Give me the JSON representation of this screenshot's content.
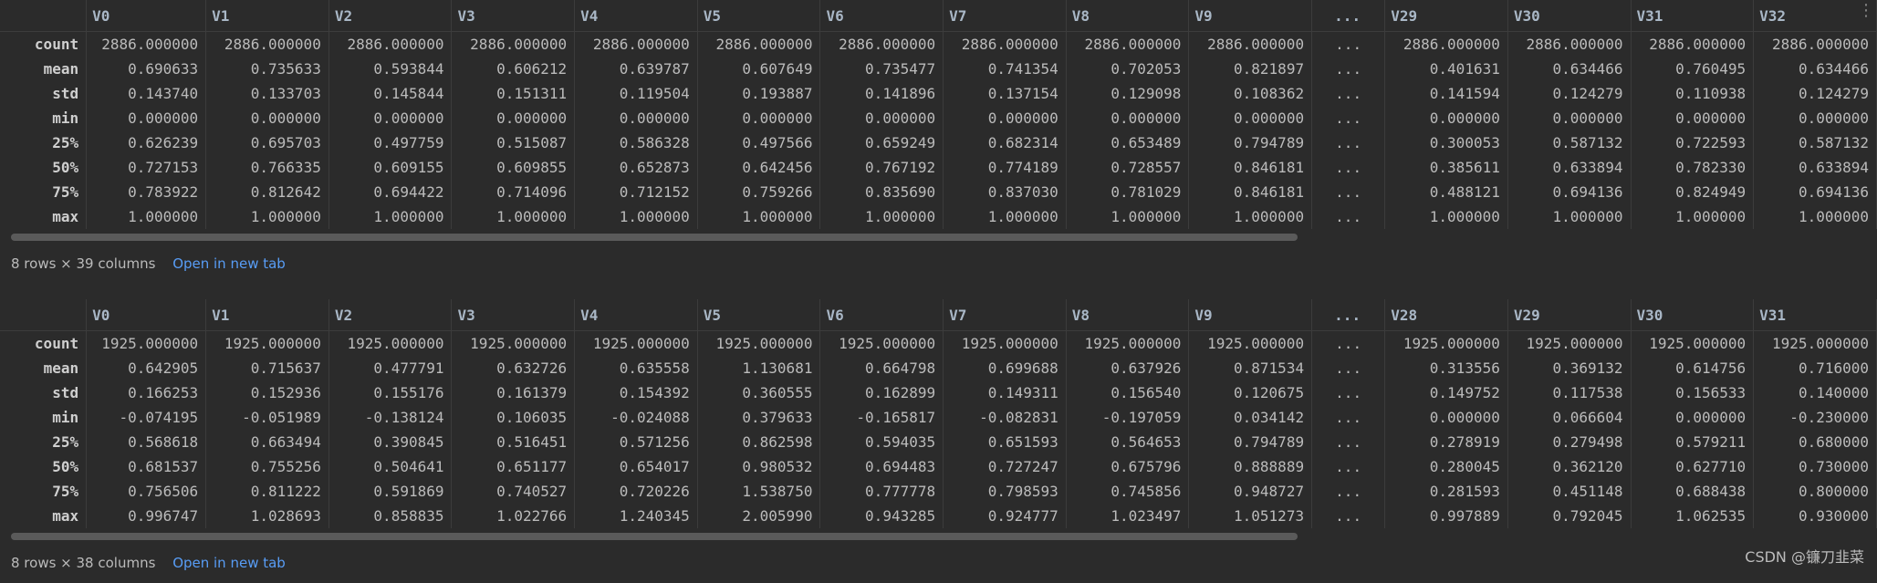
{
  "tables": [
    {
      "columns": [
        "",
        "V0",
        "V1",
        "V2",
        "V3",
        "V4",
        "V5",
        "V6",
        "V7",
        "V8",
        "V9",
        "...",
        "V29",
        "V30",
        "V31",
        "V32"
      ],
      "rows": [
        {
          "label": "count",
          "values": [
            "2886.000000",
            "2886.000000",
            "2886.000000",
            "2886.000000",
            "2886.000000",
            "2886.000000",
            "2886.000000",
            "2886.000000",
            "2886.000000",
            "2886.000000",
            "...",
            "2886.000000",
            "2886.000000",
            "2886.000000",
            "2886.000000"
          ]
        },
        {
          "label": "mean",
          "values": [
            "0.690633",
            "0.735633",
            "0.593844",
            "0.606212",
            "0.639787",
            "0.607649",
            "0.735477",
            "0.741354",
            "0.702053",
            "0.821897",
            "...",
            "0.401631",
            "0.634466",
            "0.760495",
            "0.634466"
          ]
        },
        {
          "label": "std",
          "values": [
            "0.143740",
            "0.133703",
            "0.145844",
            "0.151311",
            "0.119504",
            "0.193887",
            "0.141896",
            "0.137154",
            "0.129098",
            "0.108362",
            "...",
            "0.141594",
            "0.124279",
            "0.110938",
            "0.124279"
          ]
        },
        {
          "label": "min",
          "values": [
            "0.000000",
            "0.000000",
            "0.000000",
            "0.000000",
            "0.000000",
            "0.000000",
            "0.000000",
            "0.000000",
            "0.000000",
            "0.000000",
            "...",
            "0.000000",
            "0.000000",
            "0.000000",
            "0.000000"
          ]
        },
        {
          "label": "25%",
          "values": [
            "0.626239",
            "0.695703",
            "0.497759",
            "0.515087",
            "0.586328",
            "0.497566",
            "0.659249",
            "0.682314",
            "0.653489",
            "0.794789",
            "...",
            "0.300053",
            "0.587132",
            "0.722593",
            "0.587132"
          ]
        },
        {
          "label": "50%",
          "values": [
            "0.727153",
            "0.766335",
            "0.609155",
            "0.609855",
            "0.652873",
            "0.642456",
            "0.767192",
            "0.774189",
            "0.728557",
            "0.846181",
            "...",
            "0.385611",
            "0.633894",
            "0.782330",
            "0.633894"
          ]
        },
        {
          "label": "75%",
          "values": [
            "0.783922",
            "0.812642",
            "0.694422",
            "0.714096",
            "0.712152",
            "0.759266",
            "0.835690",
            "0.837030",
            "0.781029",
            "0.846181",
            "...",
            "0.488121",
            "0.694136",
            "0.824949",
            "0.694136"
          ]
        },
        {
          "label": "max",
          "values": [
            "1.000000",
            "1.000000",
            "1.000000",
            "1.000000",
            "1.000000",
            "1.000000",
            "1.000000",
            "1.000000",
            "1.000000",
            "1.000000",
            "...",
            "1.000000",
            "1.000000",
            "1.000000",
            "1.000000"
          ]
        }
      ],
      "footer_text": "8 rows × 39 columns",
      "open_link": "Open in new tab"
    },
    {
      "columns": [
        "",
        "V0",
        "V1",
        "V2",
        "V3",
        "V4",
        "V5",
        "V6",
        "V7",
        "V8",
        "V9",
        "...",
        "V28",
        "V29",
        "V30",
        "V31"
      ],
      "rows": [
        {
          "label": "count",
          "values": [
            "1925.000000",
            "1925.000000",
            "1925.000000",
            "1925.000000",
            "1925.000000",
            "1925.000000",
            "1925.000000",
            "1925.000000",
            "1925.000000",
            "1925.000000",
            "...",
            "1925.000000",
            "1925.000000",
            "1925.000000",
            "1925.000000"
          ]
        },
        {
          "label": "mean",
          "values": [
            "0.642905",
            "0.715637",
            "0.477791",
            "0.632726",
            "0.635558",
            "1.130681",
            "0.664798",
            "0.699688",
            "0.637926",
            "0.871534",
            "...",
            "0.313556",
            "0.369132",
            "0.614756",
            "0.716000"
          ]
        },
        {
          "label": "std",
          "values": [
            "0.166253",
            "0.152936",
            "0.155176",
            "0.161379",
            "0.154392",
            "0.360555",
            "0.162899",
            "0.149311",
            "0.156540",
            "0.120675",
            "...",
            "0.149752",
            "0.117538",
            "0.156533",
            "0.140000"
          ]
        },
        {
          "label": "min",
          "values": [
            "-0.074195",
            "-0.051989",
            "-0.138124",
            "0.106035",
            "-0.024088",
            "0.379633",
            "-0.165817",
            "-0.082831",
            "-0.197059",
            "0.034142",
            "...",
            "0.000000",
            "0.066604",
            "0.000000",
            "-0.230000"
          ]
        },
        {
          "label": "25%",
          "values": [
            "0.568618",
            "0.663494",
            "0.390845",
            "0.516451",
            "0.571256",
            "0.862598",
            "0.594035",
            "0.651593",
            "0.564653",
            "0.794789",
            "...",
            "0.278919",
            "0.279498",
            "0.579211",
            "0.680000"
          ]
        },
        {
          "label": "50%",
          "values": [
            "0.681537",
            "0.755256",
            "0.504641",
            "0.651177",
            "0.654017",
            "0.980532",
            "0.694483",
            "0.727247",
            "0.675796",
            "0.888889",
            "...",
            "0.280045",
            "0.362120",
            "0.627710",
            "0.730000"
          ]
        },
        {
          "label": "75%",
          "values": [
            "0.756506",
            "0.811222",
            "0.591869",
            "0.740527",
            "0.720226",
            "1.538750",
            "0.777778",
            "0.798593",
            "0.745856",
            "0.948727",
            "...",
            "0.281593",
            "0.451148",
            "0.688438",
            "0.800000"
          ]
        },
        {
          "label": "max",
          "values": [
            "0.996747",
            "1.028693",
            "0.858835",
            "1.022766",
            "1.240345",
            "2.005990",
            "0.943285",
            "0.924777",
            "1.023497",
            "1.051273",
            "...",
            "0.997889",
            "0.792045",
            "1.062535",
            "0.930000"
          ]
        }
      ],
      "footer_text": "8 rows × 38 columns",
      "open_link": "Open in new tab"
    }
  ],
  "watermark": "CSDN @镰刀韭菜",
  "more_icon": "vertical-ellipsis-icon"
}
